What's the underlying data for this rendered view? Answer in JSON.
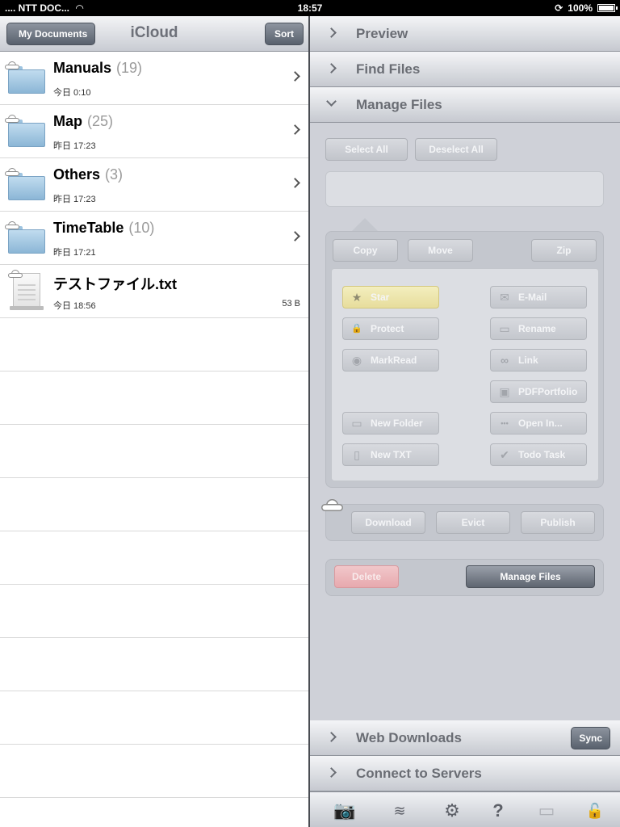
{
  "status_bar": {
    "carrier": ".... NTT DOC...",
    "time": "18:57",
    "battery": "100%",
    "battery_level": 1.0
  },
  "left_pane": {
    "back_label": "My Documents",
    "title": "iCloud",
    "sort_label": "Sort",
    "items": [
      {
        "name": "Manuals",
        "count": "(19)",
        "date": "今日 0:10",
        "type": "folder",
        "size": ""
      },
      {
        "name": "Map",
        "count": "(25)",
        "date": "昨日 17:23",
        "type": "folder",
        "size": ""
      },
      {
        "name": "Others",
        "count": "(3)",
        "date": "昨日 17:23",
        "type": "folder",
        "size": ""
      },
      {
        "name": "TimeTable",
        "count": "(10)",
        "date": "昨日 17:21",
        "type": "folder",
        "size": ""
      },
      {
        "name": "テストファイル.txt",
        "count": "",
        "date": "今日 18:56",
        "type": "file",
        "size": "53 B"
      }
    ]
  },
  "right_pane": {
    "sections_top": [
      "Preview",
      "Find Files",
      "Manage Files"
    ],
    "manage": {
      "select_all": "Select All",
      "deselect_all": "Deselect All",
      "copy": "Copy",
      "move": "Move",
      "zip": "Zip",
      "actions_left": [
        {
          "label": "Star",
          "icon": "star-icon",
          "glyph": "★"
        },
        {
          "label": "Protect",
          "icon": "lock-icon",
          "glyph": "🔒"
        },
        {
          "label": "MarkRead",
          "icon": "eye-icon",
          "glyph": "◉"
        },
        {
          "label": "New Folder",
          "icon": "new-folder-icon",
          "glyph": "▭"
        },
        {
          "label": "New TXT",
          "icon": "new-txt-icon",
          "glyph": "▯"
        }
      ],
      "actions_right": [
        {
          "label": "E-Mail",
          "icon": "envelope-icon",
          "glyph": "✉"
        },
        {
          "label": "Rename",
          "icon": "rename-icon",
          "glyph": "▭"
        },
        {
          "label": "Link",
          "icon": "link-icon",
          "glyph": "∞"
        },
        {
          "label": "PDFPortfolio",
          "icon": "pdf-portfolio-icon",
          "glyph": "▣"
        },
        {
          "label": "Open In...",
          "icon": "ellipsis-icon",
          "glyph": "•••"
        },
        {
          "label": "Todo Task",
          "icon": "checkmark-icon",
          "glyph": "✔"
        }
      ],
      "download": "Download",
      "evict": "Evict",
      "publish": "Publish",
      "delete": "Delete",
      "manage_files": "Manage Files"
    },
    "sections_bottom": [
      "Web Downloads",
      "Connect to Servers"
    ],
    "sync_label": "Sync",
    "toolbar_icons": [
      "camera-icon",
      "wifi-icon",
      "gear-icon",
      "help-icon",
      "monitor-icon",
      "unlock-icon"
    ]
  },
  "colors": {
    "accent_dark": "#59616d",
    "panel_bg": "#cfd1d8",
    "delete_red": "#e7a9ae",
    "star_yellow": "#e7dd9c"
  }
}
